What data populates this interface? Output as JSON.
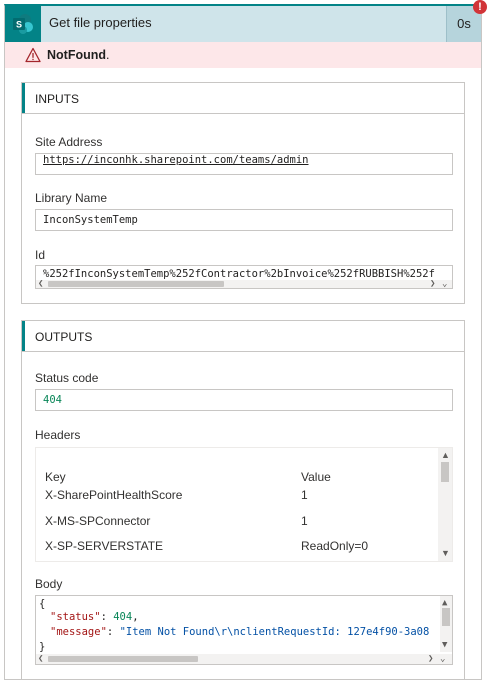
{
  "action": {
    "title": "Get file properties",
    "duration": "0s",
    "error_badge": "!"
  },
  "error": {
    "text": "NotFound",
    "suffix": "."
  },
  "inputs": {
    "title": "INPUTS",
    "site_address": {
      "label": "Site Address",
      "value": "https://inconhk.sharepoint.com/teams/admin"
    },
    "library_name": {
      "label": "Library Name",
      "value": "InconSystemTemp"
    },
    "id": {
      "label": "Id",
      "value": "%252fInconSystemTemp%252fContractor%2bInvoice%252fRUBBISH%252f"
    }
  },
  "outputs": {
    "title": "OUTPUTS",
    "status_code": {
      "label": "Status code",
      "value": "404"
    },
    "headers": {
      "label": "Headers",
      "columns": {
        "key": "Key",
        "value": "Value"
      },
      "rows": [
        {
          "key": "X-SharePointHealthScore",
          "value": "1"
        },
        {
          "key": "X-MS-SPConnector",
          "value": "1"
        },
        {
          "key": "X-SP-SERVERSTATE",
          "value": "ReadOnly=0"
        }
      ]
    },
    "body": {
      "label": "Body",
      "open_brace": "{",
      "close_brace": "}",
      "status_key": "\"status\"",
      "status_value": "404",
      "message_key": "\"message\"",
      "message_value": "\"Item Not Found\\r\\nclientRequestId: 127e4f90-3a08"
    }
  },
  "colors": {
    "accent": "#038387",
    "header_bg": "#cfe4ea",
    "error_bg": "#fde7e9",
    "error_badge": "#d13438"
  }
}
